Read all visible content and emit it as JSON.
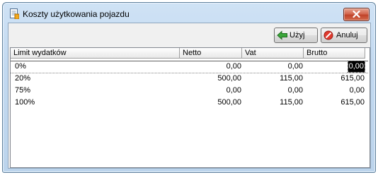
{
  "window": {
    "title": "Koszty użytkowania pojazdu"
  },
  "toolbar": {
    "apply_label": "Użyj",
    "cancel_label": "Anuluj"
  },
  "table": {
    "columns": [
      "Limit wydatków",
      "Netto",
      "Vat",
      "Brutto"
    ],
    "rows": [
      {
        "limit": "0%",
        "netto": "0,00",
        "vat": "0,00",
        "brutto": "0,00"
      },
      {
        "limit": "20%",
        "netto": "500,00",
        "vat": "115,00",
        "brutto": "615,00"
      },
      {
        "limit": "75%",
        "netto": "0,00",
        "vat": "0,00",
        "brutto": "0,00"
      },
      {
        "limit": "100%",
        "netto": "500,00",
        "vat": "115,00",
        "brutto": "615,00"
      }
    ]
  },
  "colors": {
    "titlebar": "#c2d9f0",
    "close_button": "#c0432a",
    "apply_icon": "#2f9a2f",
    "cancel_icon": "#d9281e"
  },
  "icons": {
    "app": "document-edit-icon",
    "close": "close-icon",
    "apply": "arrow-left-icon",
    "cancel": "cancel-icon"
  }
}
